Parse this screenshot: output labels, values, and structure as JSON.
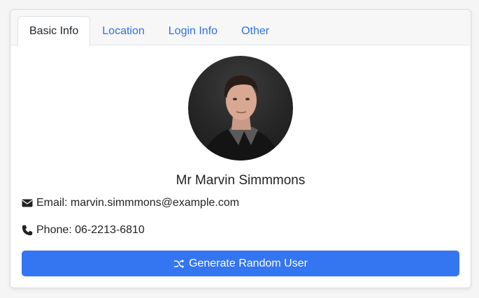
{
  "tabs": [
    {
      "label": "Basic Info",
      "active": true
    },
    {
      "label": "Location",
      "active": false
    },
    {
      "label": "Login Info",
      "active": false
    },
    {
      "label": "Other",
      "active": false
    }
  ],
  "profile": {
    "name": "Mr Marvin Simmmons",
    "email_label": "Email: marvin.simmmons@example.com",
    "phone_label": "Phone: 06-2213-6810",
    "avatar_icon": "user-photo"
  },
  "icons": {
    "email": "envelope-icon",
    "phone": "phone-icon",
    "button": "shuffle-icon"
  },
  "button": {
    "label": "Generate Random User"
  },
  "colors": {
    "accent": "#3475f2",
    "tab_link": "#2f6fe4",
    "text": "#212529"
  }
}
